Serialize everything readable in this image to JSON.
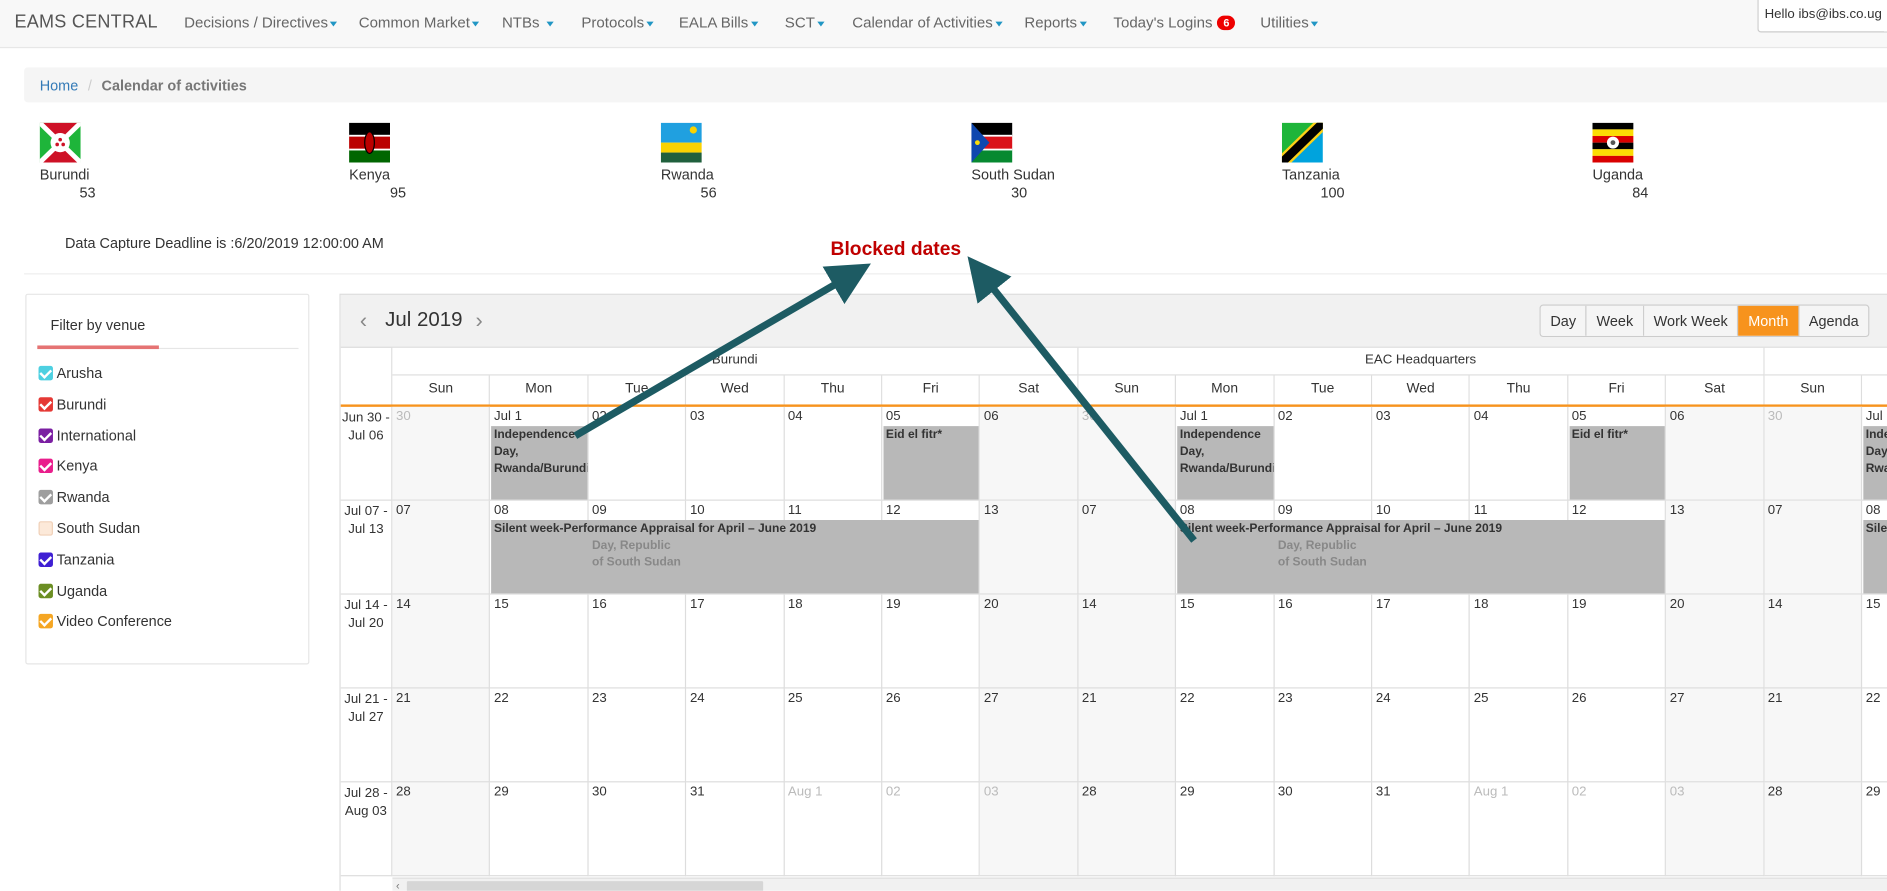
{
  "brand": "EAMS CENTRAL",
  "nav": [
    "Decisions / Directives",
    "Common Market",
    "NTBs",
    "Protocols",
    "EALA Bills",
    "SCT",
    "Calendar of Activities",
    "Reports",
    "Today's Logins",
    "Utilities"
  ],
  "logins_badge": "6",
  "user": "Hello ibs@ibs.co.ug",
  "breadcrumb": {
    "home": "Home",
    "current": "Calendar of activities"
  },
  "countries": [
    {
      "name": "Burundi",
      "count": "53"
    },
    {
      "name": "Kenya",
      "count": "95"
    },
    {
      "name": "Rwanda",
      "count": "56"
    },
    {
      "name": "South Sudan",
      "count": "30"
    },
    {
      "name": "Tanzania",
      "count": "100"
    },
    {
      "name": "Uganda",
      "count": "84"
    }
  ],
  "deadline": "Data Capture Deadline is :6/20/2019 12:00:00 AM",
  "annotation": "Blocked dates",
  "filter": {
    "title": "Filter by venue",
    "items": [
      {
        "label": "Arusha",
        "color": "#4dd0e1",
        "checked": true
      },
      {
        "label": "Burundi",
        "color": "#e53935",
        "checked": true
      },
      {
        "label": "International",
        "color": "#7b1fa2",
        "checked": true
      },
      {
        "label": "Kenya",
        "color": "#e91e8c",
        "checked": true
      },
      {
        "label": "Rwanda",
        "color": "#9e9e9e",
        "checked": true
      },
      {
        "label": "South Sudan",
        "color": "#fce9d9",
        "checked": false
      },
      {
        "label": "Tanzania",
        "color": "#3f1fd3",
        "checked": true
      },
      {
        "label": "Uganda",
        "color": "#6b8e23",
        "checked": true
      },
      {
        "label": "Video Conference",
        "color": "#f5a623",
        "checked": true
      }
    ]
  },
  "calendar": {
    "title": "Jul 2019",
    "views": [
      "Day",
      "Week",
      "Work Week",
      "Month",
      "Agenda"
    ],
    "active_view": "Month",
    "groups": [
      "Burundi",
      "EAC Headquarters"
    ],
    "days": [
      "Sun",
      "Mon",
      "Tue",
      "Wed",
      "Thu",
      "Fri",
      "Sat"
    ],
    "weeks": [
      {
        "label": "Jun 30 - Jul 06",
        "dates": [
          "30",
          "Jul 1",
          "02",
          "03",
          "04",
          "05",
          "06"
        ]
      },
      {
        "label": "Jul 07 - Jul 13",
        "dates": [
          "07",
          "08",
          "09",
          "10",
          "11",
          "12",
          "13"
        ]
      },
      {
        "label": "Jul 14 - Jul 20",
        "dates": [
          "14",
          "15",
          "16",
          "17",
          "18",
          "19",
          "20"
        ]
      },
      {
        "label": "Jul 21 - Jul 27",
        "dates": [
          "21",
          "22",
          "23",
          "24",
          "25",
          "26",
          "27"
        ]
      },
      {
        "label": "Jul 28 - Aug 03",
        "dates": [
          "28",
          "29",
          "30",
          "31",
          "Aug 1",
          "02",
          "03"
        ]
      }
    ],
    "events": {
      "independence": "Independence Day, Rwanda/Burundi",
      "independence_short": "Inde Day, Rwa",
      "eid": "Eid el fitr*",
      "silent": "Silent week-Performance Appraisal for April – June 2019",
      "silent_short": "Silen",
      "ssudan": "Independence Day, Republic of South Sudan",
      "ssudan_ghost": "Day, Republic of South Sudan"
    }
  }
}
